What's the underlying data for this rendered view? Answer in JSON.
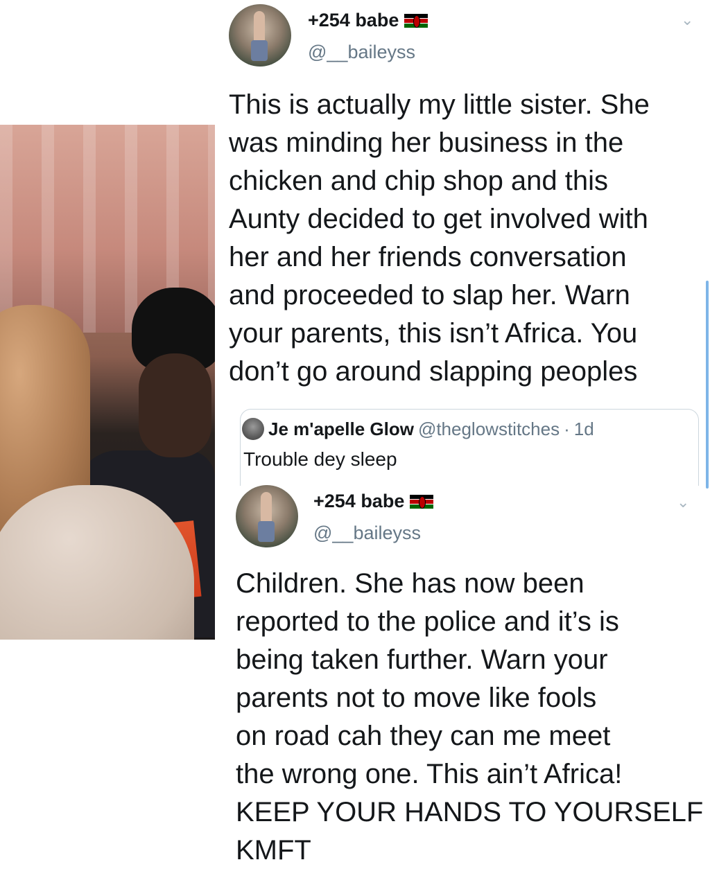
{
  "tweet1": {
    "display_name": "+254 babe",
    "handle": "@__baileyss",
    "flag_icon": "kenya-flag-icon",
    "menu_icon": "chevron-down-icon",
    "text": "This is actually my little sister. She\nwas minding her business in the\nchicken and chip shop and this\nAunty decided to get involved with\nher and her friends conversation\nand proceeded to slap her. Warn\nyour parents, this isn’t Africa. You\ndon’t go around slapping peoples"
  },
  "quoted": {
    "display_name": "Je m'apelle Glow",
    "handle": "@theglowstitches",
    "separator": "·",
    "time": "1d",
    "text": "Trouble dey sleep"
  },
  "tweet2": {
    "display_name": "+254 babe",
    "handle": "@__baileyss",
    "flag_icon": "kenya-flag-icon",
    "menu_icon": "chevron-down-icon",
    "text": "Children. She has now been\nreported to the police and it’s is\nbeing taken further. Warn your\nparents not to move like fools\non road cah they can me meet\nthe wrong one. This ain’t Africa!\nKEEP YOUR HANDS TO YOURSELF\nKMFT"
  },
  "colors": {
    "text_primary": "#14171a",
    "text_secondary": "#657786",
    "border": "#ccd6dd",
    "scrollbar": "#7eb5e8"
  }
}
